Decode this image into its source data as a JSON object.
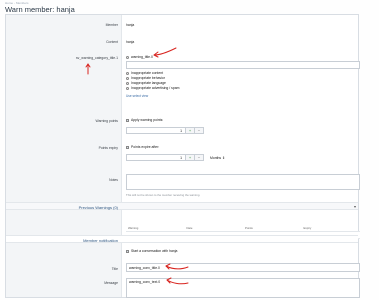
{
  "breadcrumb": [
    "Home",
    "Members"
  ],
  "title": "Warn member: hanja",
  "fields": {
    "member_label": "Member",
    "member_value": "hanja",
    "content_label": "Content",
    "content_value": "hanja",
    "category_label": "sv_warning_category_title.1",
    "options": [
      "warning_title.0",
      "Inappropriate content",
      "Inappropriate behavior",
      "Inappropriate language",
      "Inappropriate advertising / spam"
    ],
    "use_select_label": "Use select view",
    "points_label": "Warning points",
    "apply_points_label": "Apply warning points:",
    "points_value": "1",
    "expiry_label": "Points expiry",
    "expire_after_label": "Points expire after:",
    "expiry_value": "1",
    "expiry_unit": "Months",
    "notes_label": "Notes",
    "notes_hint": "This will not be shown to the member receiving the warning."
  },
  "previous": {
    "title": "Previous Warnings (0)",
    "columns": [
      "Warning",
      "Date",
      "Points",
      "Expiry"
    ]
  },
  "notification": {
    "title": "Member notification",
    "start_conv_label": "Start a conversation with hanja",
    "title_label": "Title",
    "title_value": "warning_conv_title.0",
    "message_label": "Message",
    "message_value": "warning_conv_text.0"
  },
  "colors": {
    "annotation": "#d8231e",
    "link": "#3d6ea7",
    "accent": "#2f5782"
  }
}
